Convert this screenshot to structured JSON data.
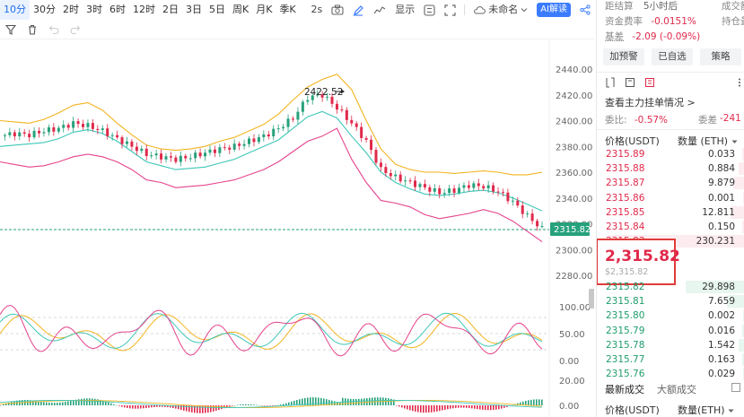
{
  "toolbar": {
    "timeframes": [
      "10分",
      "30分",
      "2时",
      "3时",
      "6时",
      "12时",
      "2日",
      "3日",
      "5日",
      "周K",
      "月K",
      "季K"
    ],
    "active_timeframe": "10分",
    "interval_label": "2s",
    "display_label": "显示",
    "layout_name": "未命名",
    "ai_label": "AI解读"
  },
  "chart": {
    "y_axis_labels": [
      "2440.00",
      "2420.00",
      "2400.00",
      "2380.00",
      "2360.00",
      "2340.00",
      "2320.00",
      "2300.00",
      "2280.00"
    ],
    "current_price_tag": "2315.82",
    "high_annotation": "2422.52",
    "kdj_axis_labels": [
      "100.00",
      "50.00",
      "0.00"
    ],
    "kdj_levels": [
      80,
      50,
      20
    ],
    "macd_axis_labels": [
      "20.00",
      "0.00"
    ],
    "colors": {
      "up": "#26a17b",
      "down": "#e0294a",
      "upper_band": "#f2b41f",
      "middle_band": "#3ec7b8",
      "lower_band": "#e5448d"
    }
  },
  "chart_data": {
    "type": "line",
    "title": "",
    "ylim": [
      2270,
      2450
    ],
    "series": [
      {
        "values": [
          2388,
          2390,
          2389,
          2392,
          2394,
          2398,
          2396,
          2392,
          2386,
          2380,
          2374,
          2372,
          2370,
          2372,
          2375,
          2378,
          2380,
          2384,
          2388,
          2394,
          2402,
          2418,
          2420,
          2410,
          2398,
          2384,
          2362,
          2356,
          2352,
          2348,
          2344,
          2346,
          2350,
          2349,
          2345,
          2337,
          2326,
          2316
        ]
      },
      {
        "values": [
          2380,
          2381,
          2382,
          2383,
          2386,
          2391,
          2393,
          2390,
          2384,
          2376,
          2368,
          2365,
          2362,
          2363,
          2364,
          2367,
          2370,
          2375,
          2380,
          2385,
          2394,
          2403,
          2407,
          2402,
          2388,
          2375,
          2360,
          2352,
          2347,
          2343,
          2342,
          2343,
          2345,
          2346,
          2344,
          2340,
          2335,
          2330
        ]
      },
      {
        "values": [
          2400,
          2399,
          2398,
          2401,
          2406,
          2412,
          2414,
          2408,
          2398,
          2389,
          2381,
          2378,
          2377,
          2378,
          2380,
          2384,
          2387,
          2392,
          2397,
          2405,
          2416,
          2426,
          2432,
          2436,
          2424,
          2400,
          2378,
          2366,
          2362,
          2360,
          2360,
          2359,
          2360,
          2361,
          2360,
          2358,
          2358,
          2360
        ]
      },
      {
        "values": [
          2368,
          2366,
          2364,
          2365,
          2368,
          2372,
          2374,
          2372,
          2368,
          2362,
          2354,
          2352,
          2348,
          2349,
          2350,
          2352,
          2354,
          2358,
          2362,
          2368,
          2376,
          2384,
          2388,
          2394,
          2370,
          2352,
          2338,
          2336,
          2333,
          2327,
          2324,
          2326,
          2328,
          2331,
          2328,
          2322,
          2314,
          2306
        ]
      }
    ]
  },
  "right_panel": {
    "info_rows": [
      {
        "label": "距结算",
        "value": "5小时后",
        "right": "成交额"
      },
      {
        "label": "资金费率",
        "value": "-0.0151%",
        "right": "持仓量"
      },
      {
        "label": "基差",
        "value": "-2.09 (-0.09%)"
      }
    ],
    "buttons": [
      "加预警",
      "已自选",
      "策略"
    ],
    "main_order_link": "查看主力挂单情况 >",
    "ratio_row": {
      "label1": "委比",
      "value1": "-0.57%",
      "label2": "委差",
      "value2": "-241"
    },
    "orderbook": {
      "price_header": "价格(USDT)",
      "qty_header": "数量 (ETH)",
      "asks": [
        {
          "price": "2315.89",
          "qty": "0.033",
          "depth": 0.02
        },
        {
          "price": "2315.88",
          "qty": "0.884",
          "depth": 0.04
        },
        {
          "price": "2315.87",
          "qty": "9.879",
          "depth": 0.08
        },
        {
          "price": "2315.86",
          "qty": "0.001",
          "depth": 0.01
        },
        {
          "price": "2315.85",
          "qty": "12.811",
          "depth": 0.1
        },
        {
          "price": "2315.84",
          "qty": "0.150",
          "depth": 0.02
        },
        {
          "price": "2315.83",
          "qty": "230.231",
          "depth": 0.92
        }
      ],
      "last_price": "2,315.82",
      "last_price_usd": "$2,315.82",
      "bids": [
        {
          "price": "2315.82",
          "qty": "29.898",
          "depth": 0.4
        },
        {
          "price": "2315.81",
          "qty": "7.659",
          "depth": 0.12
        },
        {
          "price": "2315.80",
          "qty": "0.002",
          "depth": 0.01
        },
        {
          "price": "2315.79",
          "qty": "0.016",
          "depth": 0.02
        },
        {
          "price": "2315.78",
          "qty": "1.542",
          "depth": 0.04
        },
        {
          "price": "2315.77",
          "qty": "0.163",
          "depth": 0.02
        },
        {
          "price": "2315.76",
          "qty": "0.029",
          "depth": 0.01
        }
      ]
    },
    "trades": {
      "tab_latest": "最新成交",
      "tab_large": "大额成交",
      "price_header": "价格(USDT)",
      "qty_header": "数量(ETH)"
    }
  }
}
